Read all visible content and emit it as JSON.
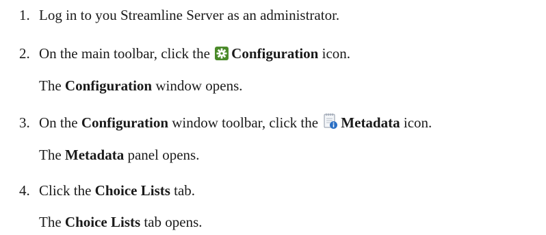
{
  "steps": [
    {
      "number": "1.",
      "text": "Log in to you Streamline Server as an administrator."
    },
    {
      "number": "2.",
      "pre": "On the main toolbar, click the",
      "icon": "gear-icon",
      "bold": "Configuration",
      "post": "icon.",
      "result_pre": "The",
      "result_bold": "Configuration",
      "result_post": "window opens."
    },
    {
      "number": "3.",
      "pre": "On the",
      "bold1": "Configuration",
      "mid": "window toolbar, click the",
      "icon": "metadata-icon",
      "bold2": "Metadata",
      "post": "icon.",
      "result_pre": "The",
      "result_bold": "Metadata",
      "result_post": "panel opens."
    },
    {
      "number": "4.",
      "pre": "Click the",
      "bold": "Choice Lists",
      "post": "tab.",
      "result_pre": "The",
      "result_bold": "Choice Lists",
      "result_post": "tab opens."
    }
  ],
  "colors": {
    "gear_icon_bg": "#4a8a2a",
    "metadata_icon_badge": "#2a6fc4"
  }
}
